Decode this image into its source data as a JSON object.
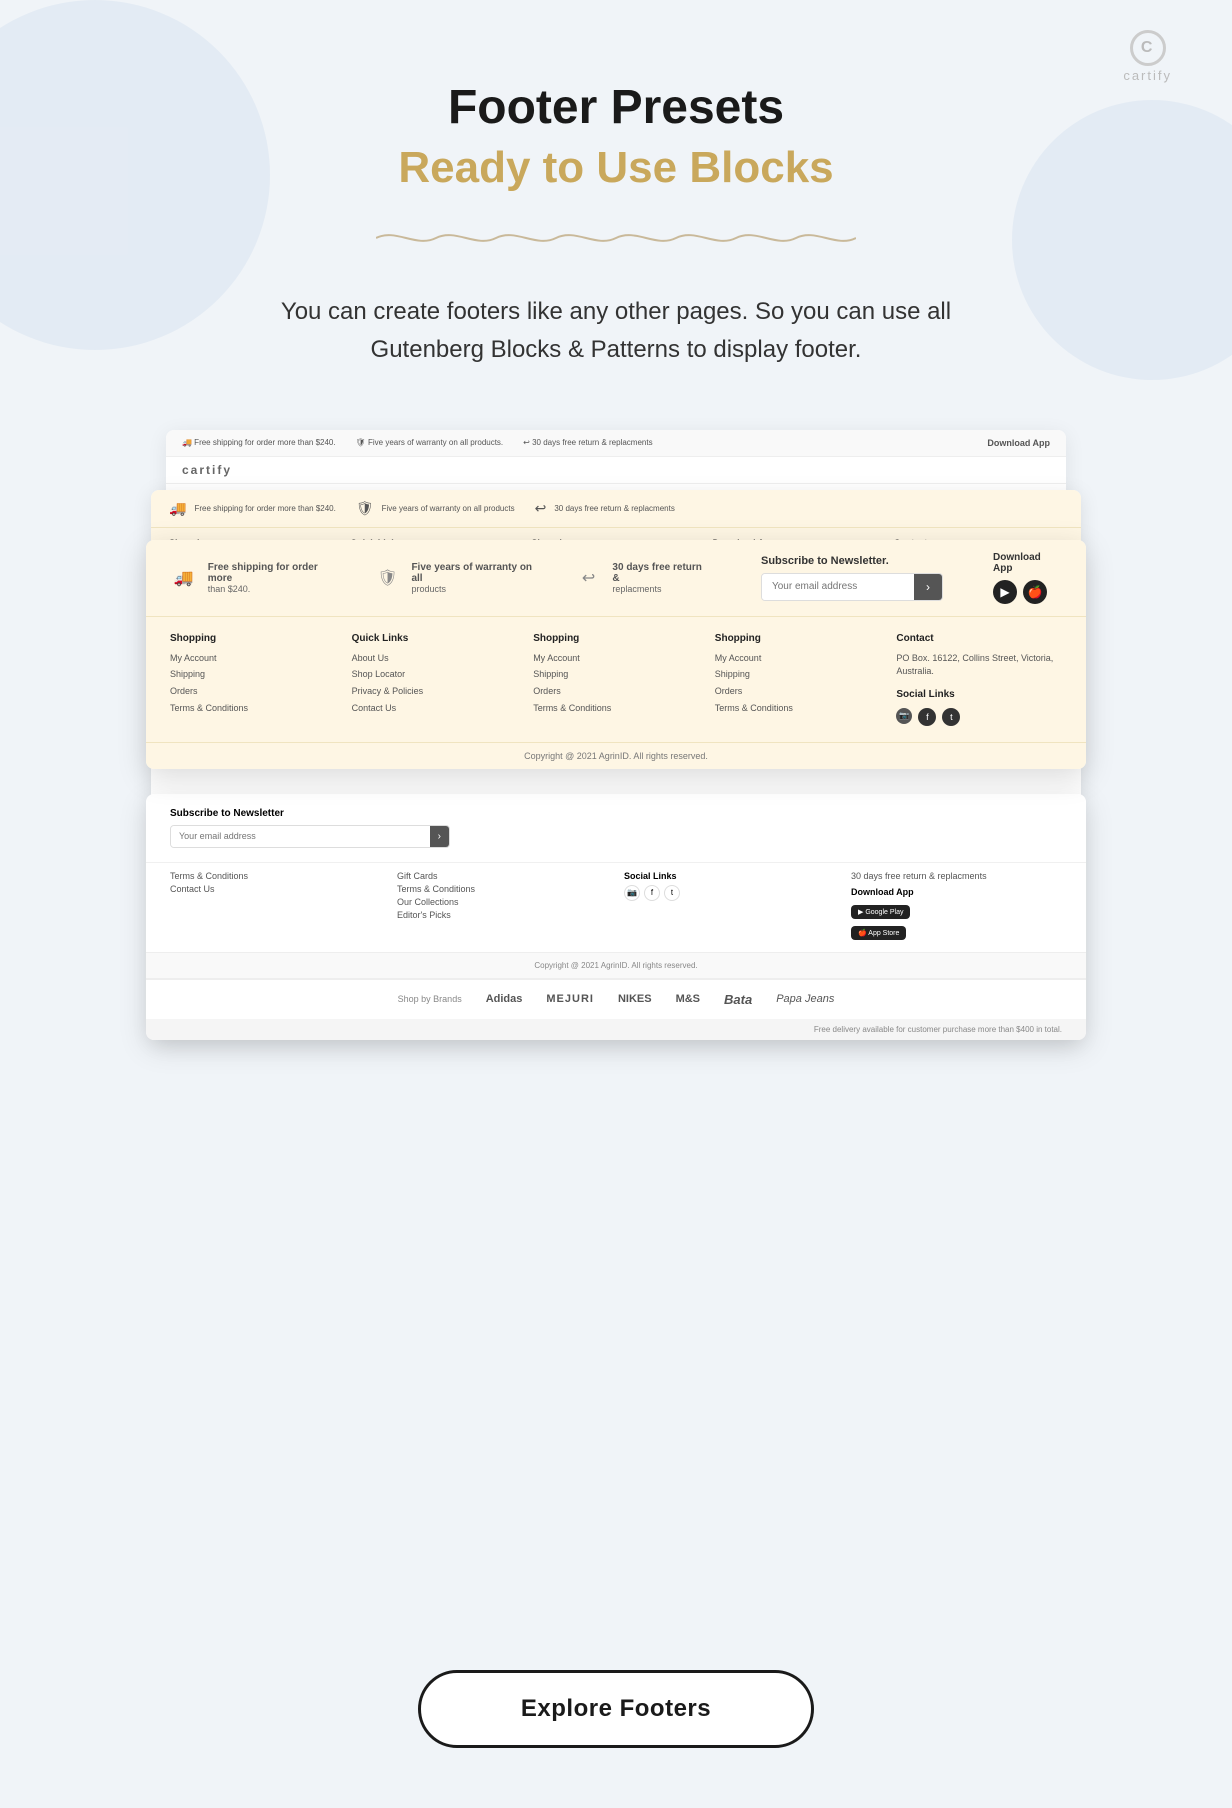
{
  "branding": {
    "logo_letter": "C",
    "name": "cartify"
  },
  "header": {
    "title": "Footer Presets",
    "subtitle": "Ready to Use Blocks",
    "description": "You can create footers like any other pages. So you can use all Gutenberg Blocks & Patterns to display footer."
  },
  "footer_preview": {
    "top_bar": [
      {
        "icon": "🚚",
        "text": "Free shipping for order more than $240."
      },
      {
        "icon": "🛡",
        "text": "Five years of warranty on all products"
      },
      {
        "icon": "↩",
        "text": "30 days free return & replacments"
      }
    ],
    "newsletter": {
      "label": "Subscribe to Newsletter.",
      "placeholder": "Your email address"
    },
    "download_app": {
      "label": "Download App",
      "google_play": "GET IT ON Google Play",
      "app_store": "Download on the App Store"
    },
    "columns": [
      {
        "title": "Shopping",
        "links": [
          "My Account",
          "Shipping",
          "Orders",
          "Terms & Conditions"
        ]
      },
      {
        "title": "Quick Links",
        "links": [
          "About Us",
          "Shop Locator",
          "Privacy & Policies",
          "Contact Us"
        ]
      },
      {
        "title": "Shopping",
        "links": [
          "My Account",
          "Shipping",
          "Orders",
          "Terms & Conditions"
        ]
      },
      {
        "title": "Shopping",
        "links": [
          "My Account",
          "Shipping",
          "Orders",
          "Terms & Conditions"
        ]
      },
      {
        "title": "Contact",
        "address": "PO Box. 16122, Collins Street, Victoria, Australia.",
        "social_label": "Social Links"
      }
    ],
    "copyright": "Copyright @ 2021 AgrinID. All rights reserved."
  },
  "back_preview": {
    "columns": [
      {
        "title": "Shopping",
        "links": [
          "My Account",
          "Shipping",
          "Orders"
        ]
      },
      {
        "title": "Quick Links",
        "links": [
          "About Us",
          "Shop Locator"
        ]
      },
      {
        "title": "Shopping",
        "links": [
          "My Account",
          "Shipping"
        ]
      },
      {
        "title": "Shopping",
        "links": [
          "My Account",
          "Shipping"
        ]
      },
      {
        "title": "Quick Links",
        "links": [
          "About Us"
        ]
      }
    ]
  },
  "bottom_footer": {
    "shop_by_brands": "Shop by Brands",
    "brands": [
      "Adidas",
      "MEJURI",
      "NIKES",
      "M&S",
      "Bata",
      "Papa Jeans"
    ],
    "free_delivery": "Free delivery available for customer purchase more than $400 in total."
  },
  "explore_button": {
    "label": "Explore Footers"
  }
}
